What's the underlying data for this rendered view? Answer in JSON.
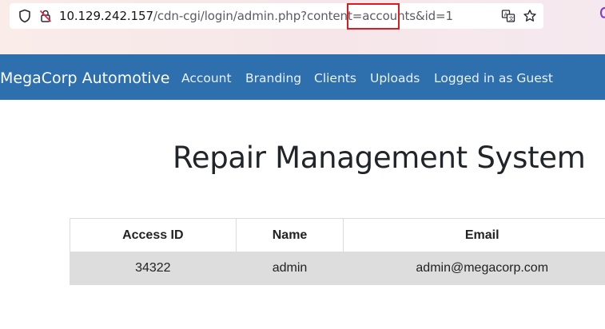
{
  "browser": {
    "url_host": "10.129.242.157",
    "url_path": "/cdn-cgi/login/admin.php?content=accounts&id=1",
    "icons": {
      "left": [
        "shield-icon",
        "lock-slash-icon"
      ],
      "right": [
        "translate-icon",
        "star-icon"
      ]
    },
    "highlight_color": "#e0191f"
  },
  "navbar": {
    "brand": "MegaCorp Automotive",
    "links": [
      "Account",
      "Branding",
      "Clients",
      "Uploads"
    ],
    "status": "Logged in as Guest",
    "background": "#2e6fae"
  },
  "main": {
    "title": "Repair Management System"
  },
  "table": {
    "headers": [
      "Access ID",
      "Name",
      "Email"
    ],
    "rows": [
      [
        "34322",
        "admin",
        "admin@megacorp.com"
      ]
    ],
    "row_background": "#dddddd"
  }
}
